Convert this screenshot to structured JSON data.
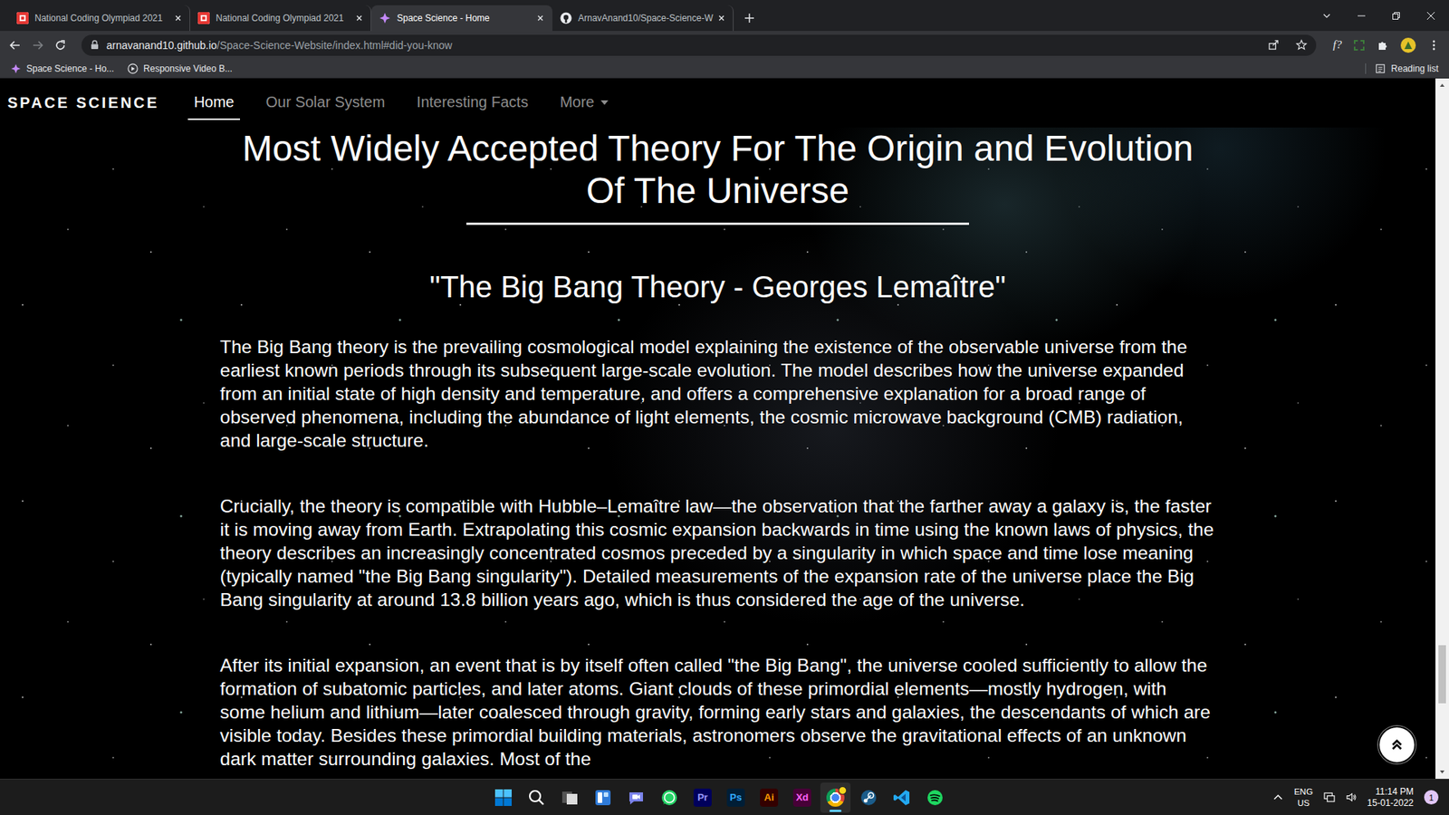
{
  "browser": {
    "tabs": [
      {
        "title": "National Coding Olympiad 2021",
        "kind": "nco",
        "selected": false
      },
      {
        "title": "National Coding Olympiad 2021",
        "kind": "nco",
        "selected": false
      },
      {
        "title": "Space Science - Home",
        "kind": "space",
        "selected": true
      },
      {
        "title": "ArnavAnand10/Space-Science-W",
        "kind": "github",
        "selected": false
      }
    ],
    "address": {
      "host": "arnavanand10.github.io",
      "path": "/Space-Science-Website/index.html#did-you-know"
    },
    "extensions": [
      {
        "kind": "text",
        "label": "f?"
      },
      {
        "kind": "dashed"
      },
      {
        "kind": "puzzle"
      },
      {
        "kind": "avatar"
      }
    ],
    "bookmarks": [
      {
        "label": "Space Science - Ho...",
        "kind": "space"
      },
      {
        "label": "Responsive Video B...",
        "kind": "video"
      }
    ],
    "reading_list": "Reading list"
  },
  "site": {
    "brand": "SPACE SCIENCE",
    "nav": [
      {
        "label": "Home",
        "selected": true,
        "dropdown": false
      },
      {
        "label": "Our Solar System",
        "selected": false,
        "dropdown": false
      },
      {
        "label": "Interesting Facts",
        "selected": false,
        "dropdown": false
      },
      {
        "label": "More",
        "selected": false,
        "dropdown": true
      }
    ],
    "heading": "Most Widely Accepted Theory For The Origin and Evolution Of The Universe",
    "subheading": "\"The Big Bang Theory - Georges Lemaître\"",
    "paragraphs": [
      "The Big Bang theory is the prevailing cosmological model explaining the existence of the observable universe from the earliest known periods through its subsequent large-scale evolution. The model describes how the universe expanded from an initial state of high density and temperature, and offers a comprehensive explanation for a broad range of observed phenomena, including the abundance of light elements, the cosmic microwave background (CMB) radiation, and large-scale structure.",
      "Crucially, the theory is compatible with Hubble–Lemaître law—the observation that the farther away a galaxy is, the faster it is moving away from Earth. Extrapolating this cosmic expansion backwards in time using the known laws of physics, the theory describes an increasingly concentrated cosmos preceded by a singularity in which space and time lose meaning (typically named \"the Big Bang singularity\"). Detailed measurements of the expansion rate of the universe place the Big Bang singularity at around 13.8 billion years ago, which is thus considered the age of the universe.",
      "After its initial expansion, an event that is by itself often called \"the Big Bang\", the universe cooled sufficiently to allow the formation of subatomic particles, and later atoms. Giant clouds of these primordial elements—mostly hydrogen, with some helium and lithium—later coalesced through gravity, forming early stars and galaxies, the descendants of which are visible today. Besides these primordial building materials, astronomers observe the gravitational effects of an unknown dark matter surrounding galaxies. Most of the"
    ],
    "scrollbar": {
      "level": 0.9
    }
  },
  "taskbar": {
    "apps": [
      {
        "kind": "windows",
        "selected": false
      },
      {
        "kind": "search",
        "selected": false
      },
      {
        "kind": "taskview",
        "selected": false
      },
      {
        "kind": "widgets",
        "selected": false
      },
      {
        "kind": "chat",
        "selected": false
      },
      {
        "kind": "whatsapp",
        "selected": false
      },
      {
        "kind": "letter",
        "label": "Pr",
        "color": "#9999ff",
        "selected": false
      },
      {
        "kind": "letter",
        "label": "Ps",
        "color": "#31a8ff",
        "selected": false
      },
      {
        "kind": "letter",
        "label": "Ai",
        "color": "#ff9a00",
        "selected": false
      },
      {
        "kind": "letter",
        "label": "Xd",
        "color": "#ff61f6",
        "selected": false
      },
      {
        "kind": "chrome",
        "selected": true,
        "badge": true
      },
      {
        "kind": "steam",
        "selected": false
      },
      {
        "kind": "vscode",
        "selected": false
      },
      {
        "kind": "spotify",
        "selected": false
      }
    ],
    "tray": {
      "language": "ENG",
      "region": "US",
      "time": "11:14 PM",
      "date": "15-01-2022",
      "notifications": "1"
    }
  }
}
